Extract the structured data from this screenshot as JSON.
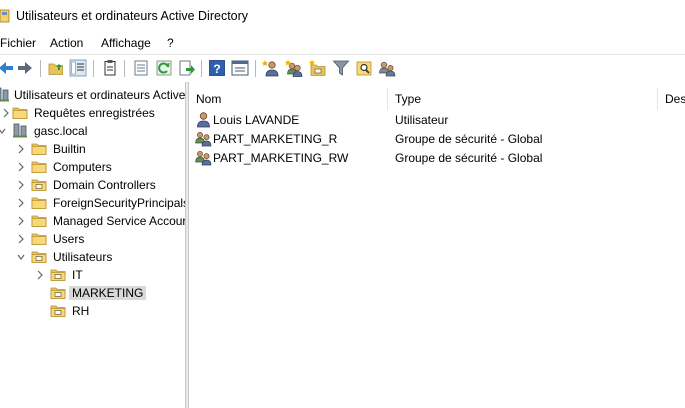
{
  "window": {
    "title": "Utilisateurs et ordinateurs Active Directory"
  },
  "menu": [
    "Fichier",
    "Action",
    "Affichage",
    "?"
  ],
  "toolbar": [
    "back-icon",
    "forward-icon",
    "up-folder-icon",
    "show-tree-icon",
    "clipboard-icon",
    "properties-icon",
    "refresh-icon",
    "export-icon",
    "help-icon",
    "console-icon",
    "new-user-icon",
    "new-group-icon",
    "new-ou-icon",
    "filter-icon",
    "find-icon",
    "delegate-icon"
  ],
  "tree": {
    "root": "Utilisateurs et ordinateurs Active",
    "items": [
      {
        "label": "Requêtes enregistrées",
        "icon": "folder-icon"
      },
      {
        "label": "gasc.local",
        "icon": "domain-icon"
      },
      {
        "label": "Builtin",
        "icon": "folder-icon"
      },
      {
        "label": "Computers",
        "icon": "folder-icon"
      },
      {
        "label": "Domain Controllers",
        "icon": "ou-icon"
      },
      {
        "label": "ForeignSecurityPrincipals",
        "icon": "folder-icon"
      },
      {
        "label": "Managed Service Accour",
        "icon": "folder-icon"
      },
      {
        "label": "Users",
        "icon": "folder-icon"
      },
      {
        "label": "Utilisateurs",
        "icon": "ou-icon"
      },
      {
        "label": "IT",
        "icon": "ou-icon"
      },
      {
        "label": "MARKETING",
        "icon": "ou-icon",
        "selected": true
      },
      {
        "label": "RH",
        "icon": "ou-icon"
      }
    ]
  },
  "list": {
    "columns": [
      "Nom",
      "Type",
      "Des"
    ],
    "rows": [
      {
        "name": "Louis LAVANDE",
        "type": "Utilisateur",
        "icon": "user-icon"
      },
      {
        "name": "PART_MARKETING_R",
        "type": "Groupe de sécurité - Global",
        "icon": "group-icon"
      },
      {
        "name": "PART_MARKETING_RW",
        "type": "Groupe de sécurité - Global",
        "icon": "group-icon"
      }
    ]
  }
}
